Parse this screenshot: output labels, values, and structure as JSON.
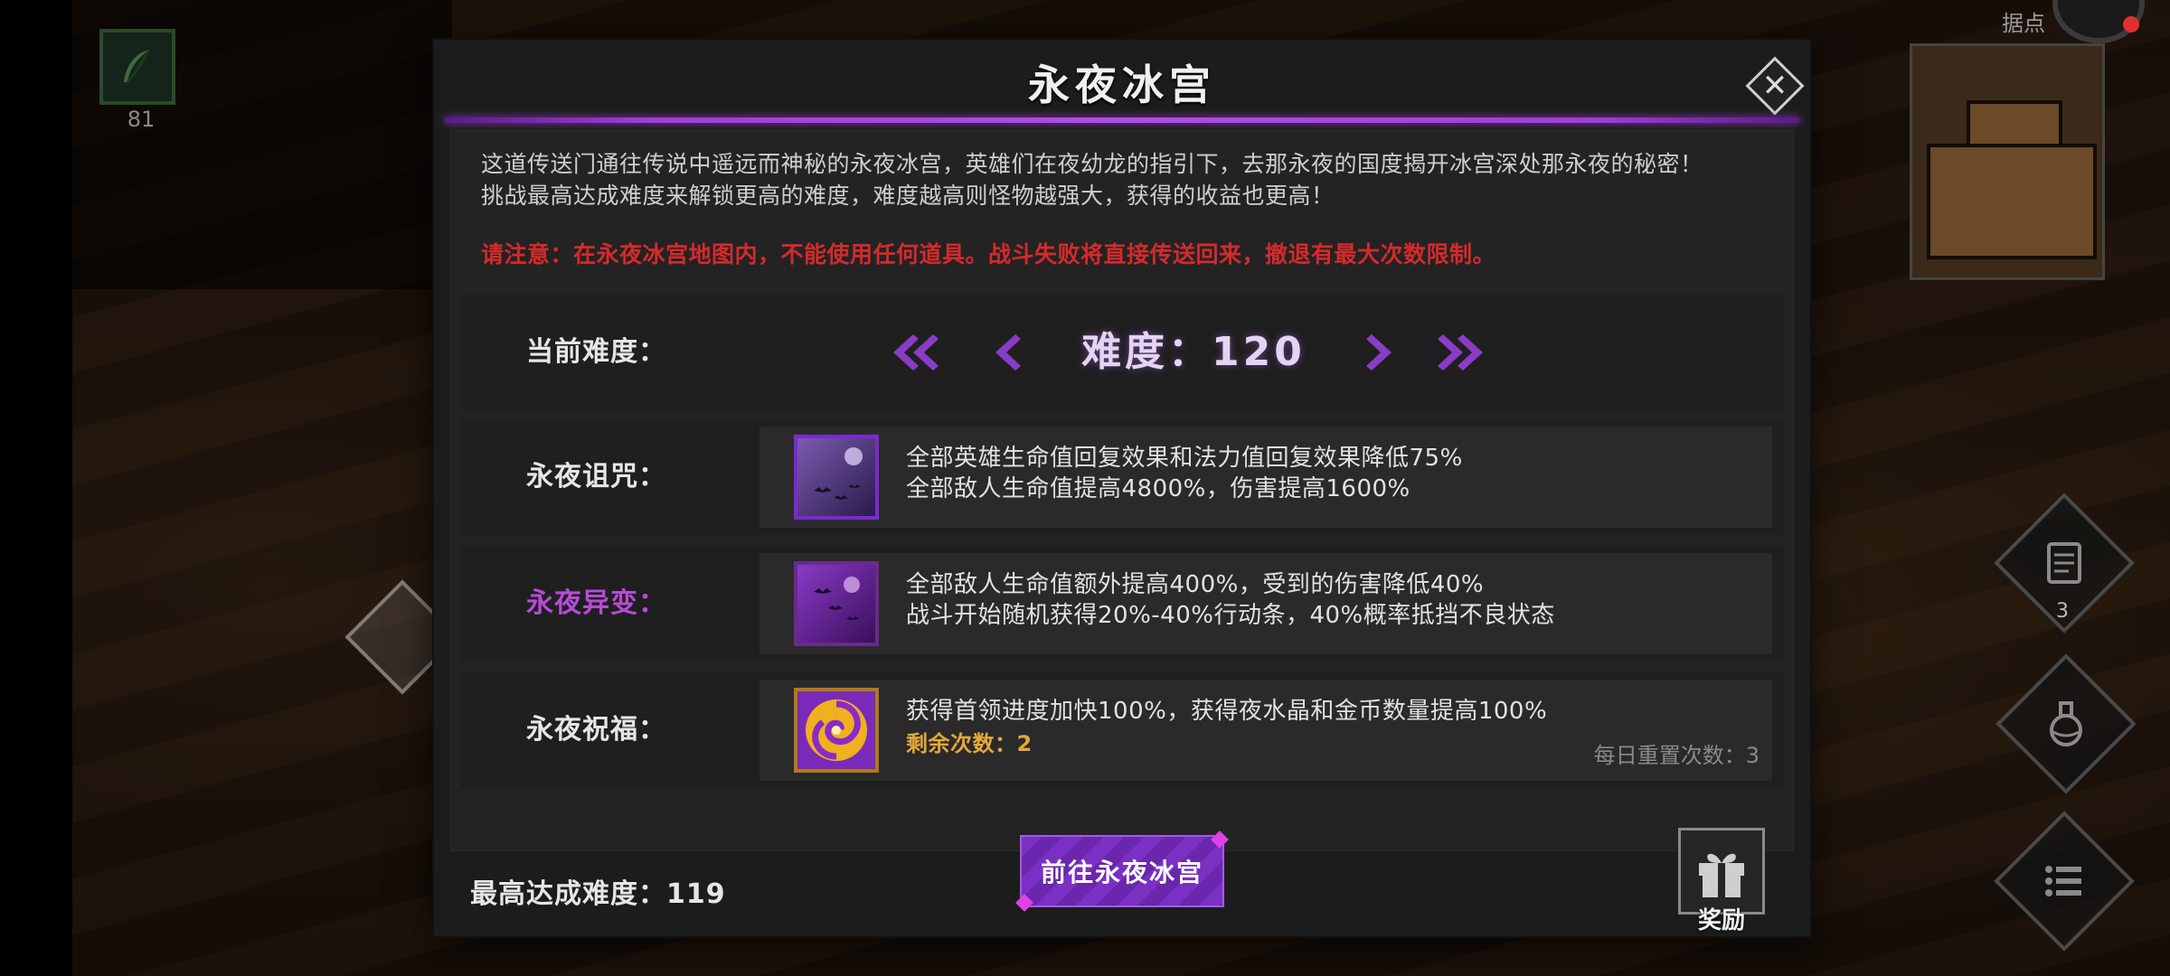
{
  "hud": {
    "item_count": "81",
    "minimap_label": "据点",
    "quest_badge": "3"
  },
  "modal": {
    "title": "永夜冰宫",
    "description_line1": "这道传送门通往传说中遥远而神秘的永夜冰宫，英雄们在夜幼龙的指引下，去那永夜的国度揭开冰宫深处那永夜的秘密！",
    "description_line2": "挑战最高达成难度来解锁更高的难度，难度越高则怪物越强大，获得的收益也更高！",
    "warning": "请注意：在永夜冰宫地图内，不能使用任何道具。战斗失败将直接传送回来，撤退有最大次数限制。",
    "difficulty": {
      "label": "当前难度：",
      "value": "难度：120"
    },
    "curse": {
      "label": "永夜诅咒：",
      "line1": "全部英雄生命值回复效果和法力值回复效果降低75%",
      "line2": "全部敌人生命值提高4800%，伤害提高1600%"
    },
    "mutation": {
      "label": "永夜异变：",
      "line1": "全部敌人生命值额外提高400%，受到的伤害降低40%",
      "line2": "战斗开始随机获得20%-40%行动条，40%概率抵挡不良状态"
    },
    "blessing": {
      "label": "永夜祝福：",
      "line1": "获得首领进度加快100%，获得夜水晶和金币数量提高100%",
      "remaining": "剩余次数：2",
      "daily_reset": "每日重置次数：3"
    },
    "best_difficulty": "最高达成难度：119",
    "go_button": "前往永夜冰宫",
    "reward_label": "奖励"
  },
  "colors": {
    "accent_purple": "#a23cdc",
    "warning_red": "#d42a2a",
    "mutation_label": "#b84bd6",
    "remaining_gold": "#e3a93a"
  },
  "icons": [
    "feather-icon",
    "close-icon",
    "double-chevron-left-icon",
    "chevron-left-icon",
    "chevron-right-icon",
    "double-chevron-right-icon",
    "bats-moon-icon",
    "bats-purple-icon",
    "vortex-icon",
    "gift-icon",
    "scroll-icon",
    "potion-icon",
    "list-menu-icon"
  ]
}
